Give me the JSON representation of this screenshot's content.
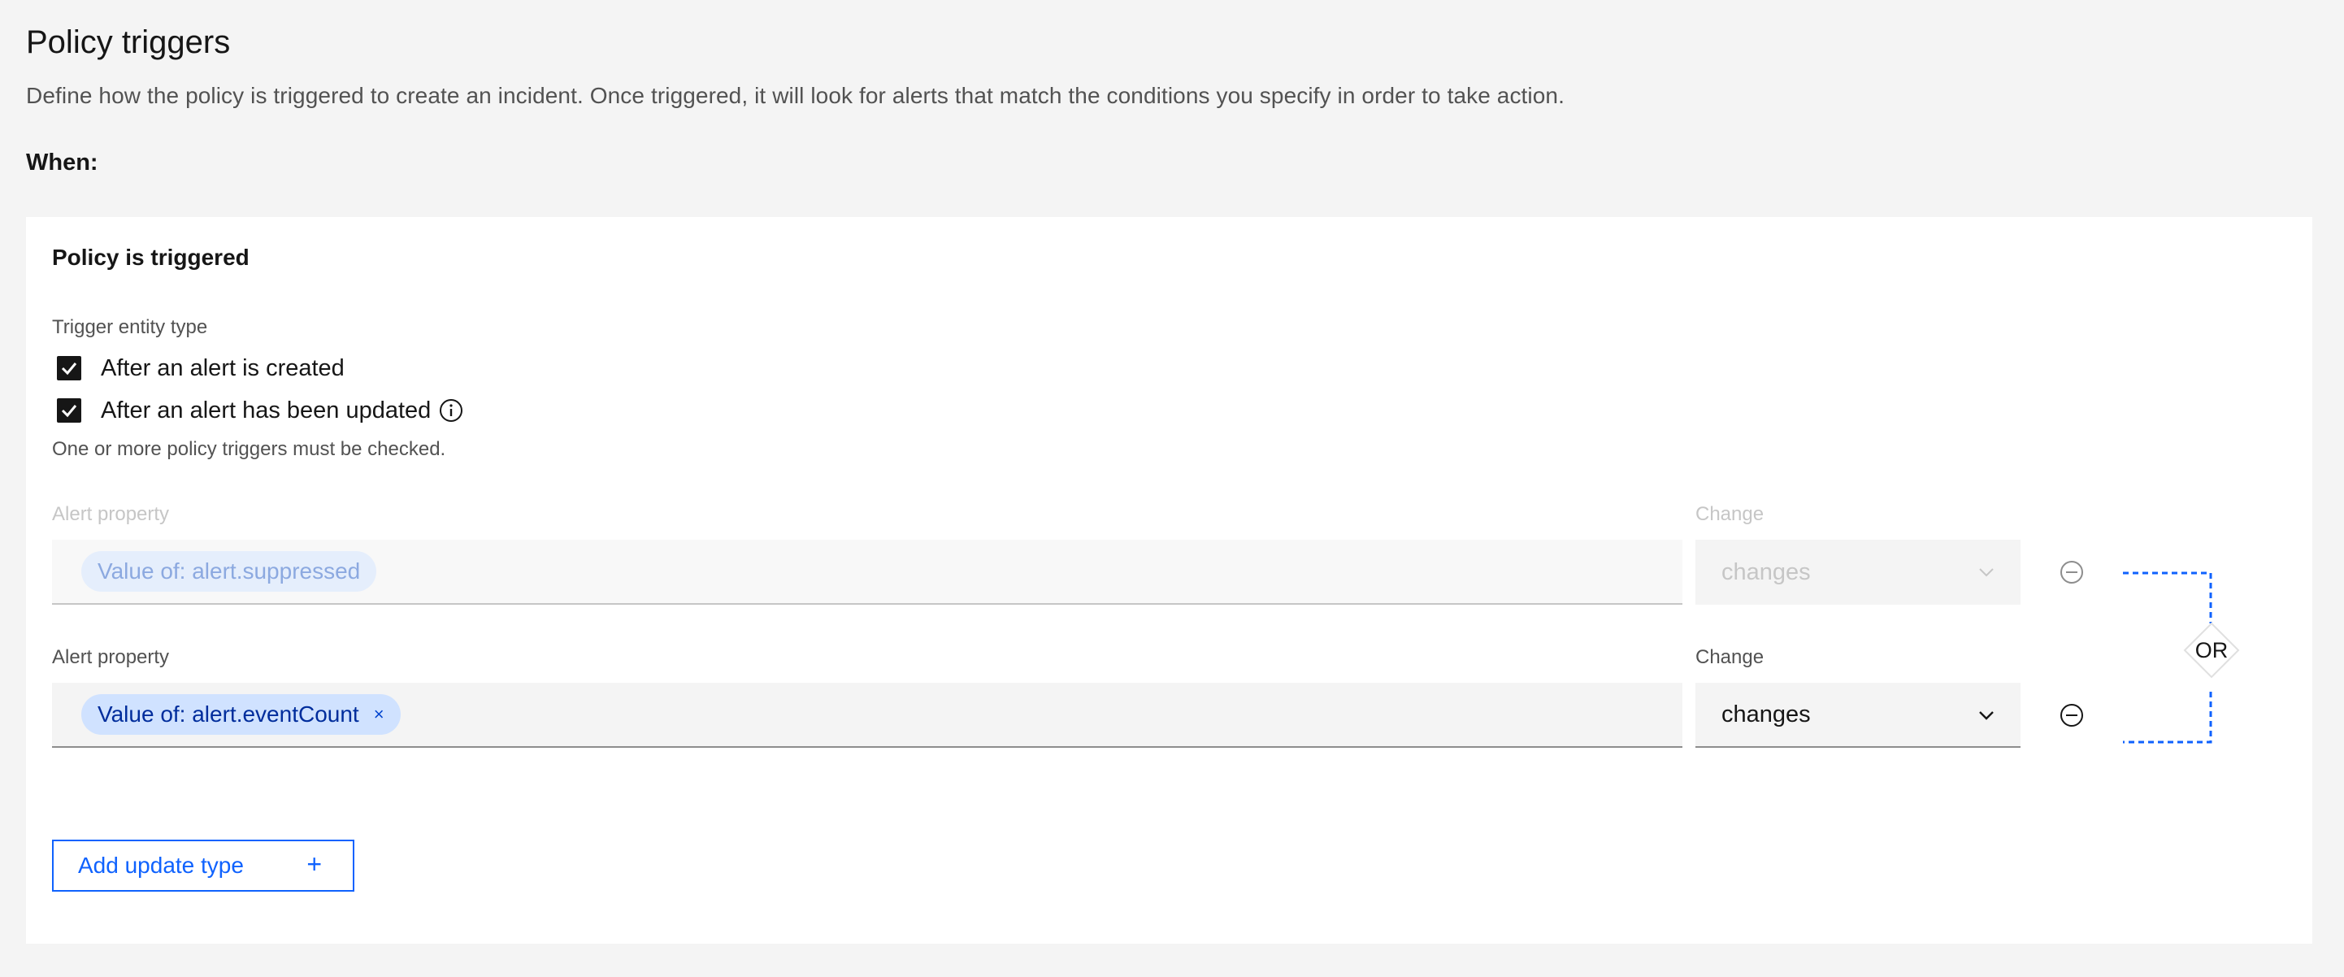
{
  "header": {
    "title": "Policy triggers",
    "description": "Define how the policy is triggered to create an incident. Once triggered, it will look for alerts that match the conditions you specify in order to take action.",
    "when_label": "When:"
  },
  "card": {
    "title": "Policy is triggered",
    "trigger_entity_label": "Trigger entity type",
    "checkboxes": [
      {
        "label": "After an alert is created",
        "checked": true
      },
      {
        "label": "After an alert has been updated",
        "checked": true
      }
    ],
    "helper_text": "One or more policy triggers must be checked."
  },
  "conditions": [
    {
      "property_label": "Alert property",
      "property_tag": "Value of: alert.suppressed",
      "change_label": "Change",
      "change_value": "changes",
      "disabled": true
    },
    {
      "property_label": "Alert property",
      "property_tag": "Value of: alert.eventCount",
      "tag_close": "×",
      "change_label": "Change",
      "change_value": "changes",
      "disabled": false
    }
  ],
  "connector": {
    "label": "OR"
  },
  "add_button": {
    "label": "Add update type",
    "icon": "+"
  },
  "colors": {
    "accent": "#0f62fe",
    "tag_bg": "#d0e2ff",
    "background": "#f4f4f4",
    "card": "#ffffff"
  }
}
